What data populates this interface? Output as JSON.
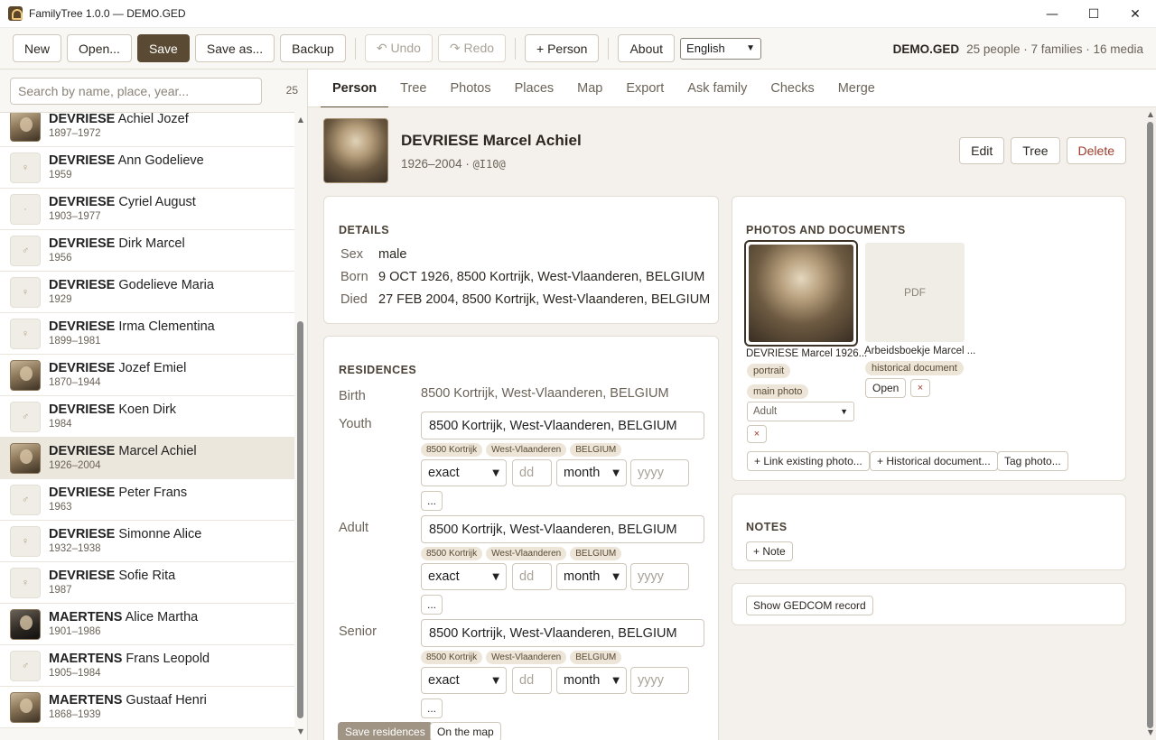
{
  "window": {
    "title": "FamilyTree 1.0.0 — DEMO.GED",
    "controls": [
      "—",
      "☐",
      "✕"
    ]
  },
  "toolbar": {
    "new": "New",
    "open": "Open...",
    "save": "Save",
    "save_as": "Save as...",
    "backup": "Backup",
    "undo": "↶ Undo",
    "redo": "↷ Redo",
    "add_person": "+ Person",
    "about": "About",
    "language": "English",
    "file_name": "DEMO.GED",
    "stats": "25 people · 7 families · 16 media"
  },
  "sidebar": {
    "search_placeholder": "Search by name, place, year...",
    "count": "25",
    "people": [
      {
        "surname": "DEVRIESE",
        "given": "Achiel Jozef",
        "years": "1897–1972",
        "thumb": "photo",
        "sex_icon": ""
      },
      {
        "surname": "DEVRIESE",
        "given": "Ann Godelieve",
        "years": "1959",
        "thumb": "female",
        "sex_icon": "♀"
      },
      {
        "surname": "DEVRIESE",
        "given": "Cyriel August",
        "years": "1903–1977",
        "thumb": "unknown",
        "sex_icon": "·"
      },
      {
        "surname": "DEVRIESE",
        "given": "Dirk Marcel",
        "years": "1956",
        "thumb": "male",
        "sex_icon": "♂"
      },
      {
        "surname": "DEVRIESE",
        "given": "Godelieve Maria",
        "years": "1929",
        "thumb": "female",
        "sex_icon": "♀"
      },
      {
        "surname": "DEVRIESE",
        "given": "Irma Clementina",
        "years": "1899–1981",
        "thumb": "female",
        "sex_icon": "♀"
      },
      {
        "surname": "DEVRIESE",
        "given": "Jozef Emiel",
        "years": "1870–1944",
        "thumb": "photo",
        "sex_icon": ""
      },
      {
        "surname": "DEVRIESE",
        "given": "Koen Dirk",
        "years": "1984",
        "thumb": "male",
        "sex_icon": "♂"
      },
      {
        "surname": "DEVRIESE",
        "given": "Marcel Achiel",
        "years": "1926–2004",
        "thumb": "photo",
        "sex_icon": "",
        "active": true
      },
      {
        "surname": "DEVRIESE",
        "given": "Peter Frans",
        "years": "1963",
        "thumb": "male",
        "sex_icon": "♂"
      },
      {
        "surname": "DEVRIESE",
        "given": "Simonne Alice",
        "years": "1932–1938",
        "thumb": "female",
        "sex_icon": "♀"
      },
      {
        "surname": "DEVRIESE",
        "given": "Sofie Rita",
        "years": "1987",
        "thumb": "female",
        "sex_icon": "♀"
      },
      {
        "surname": "MAERTENS",
        "given": "Alice Martha",
        "years": "1901–1986",
        "thumb": "dark",
        "sex_icon": ""
      },
      {
        "surname": "MAERTENS",
        "given": "Frans Leopold",
        "years": "1905–1984",
        "thumb": "male",
        "sex_icon": "♂"
      },
      {
        "surname": "MAERTENS",
        "given": "Gustaaf Henri",
        "years": "1868–1939",
        "thumb": "photo",
        "sex_icon": ""
      }
    ]
  },
  "tabs": [
    "Person",
    "Tree",
    "Photos",
    "Places",
    "Map",
    "Export",
    "Ask family",
    "Checks",
    "Merge"
  ],
  "person": {
    "name": "DEVRIESE Marcel Achiel",
    "years": "1926–2004 · ",
    "id": "@I10@",
    "edit": "Edit",
    "tree": "Tree",
    "delete": "Delete"
  },
  "details": {
    "title": "DETAILS",
    "sex_label": "Sex",
    "sex": "male",
    "born_label": "Born",
    "born": "9 OCT 1926, 8500 Kortrijk, West-Vlaanderen, BELGIUM",
    "died_label": "Died",
    "died": "27 FEB 2004, 8500 Kortrijk, West-Vlaanderen, BELGIUM"
  },
  "residences": {
    "title": "RESIDENCES",
    "birth_label": "Birth",
    "birth_value": "8500 Kortrijk, West-Vlaanderen, BELGIUM",
    "rows": [
      {
        "label": "Youth",
        "value": "8500 Kortrijk, West-Vlaanderen, BELGIUM",
        "chips": [
          "8500 Kortrijk",
          "West-Vlaanderen",
          "BELGIUM"
        ],
        "qual": "exact",
        "day": "dd",
        "month": "month",
        "year": "yyyy"
      },
      {
        "label": "Adult",
        "value": "8500 Kortrijk, West-Vlaanderen, BELGIUM",
        "chips": [
          "8500 Kortrijk",
          "West-Vlaanderen",
          "BELGIUM"
        ],
        "qual": "exact",
        "day": "dd",
        "month": "month",
        "year": "yyyy"
      },
      {
        "label": "Senior",
        "value": "8500 Kortrijk, West-Vlaanderen, BELGIUM",
        "chips": [
          "8500 Kortrijk",
          "West-Vlaanderen",
          "BELGIUM"
        ],
        "qual": "exact",
        "day": "dd",
        "month": "month",
        "year": "yyyy"
      }
    ],
    "more": "...",
    "save": "Save residences",
    "map": "On the map"
  },
  "photos": {
    "title": "PHOTOS AND DOCUMENTS",
    "main_caption": "DEVRIESE Marcel 1926...",
    "main_tags": [
      "portrait",
      "main photo"
    ],
    "main_period": "Adult",
    "pdf_label": "PDF",
    "pdf_caption": "Arbeidsboekje Marcel ...",
    "pdf_tag": "historical document",
    "open": "Open",
    "remove": "×",
    "link_existing": "+ Link existing photo...",
    "historical": "+ Historical document...",
    "tag_photo": "Tag photo..."
  },
  "notes": {
    "title": "NOTES",
    "add": "+ Note"
  },
  "gedcom": {
    "show": "Show GEDCOM record"
  }
}
